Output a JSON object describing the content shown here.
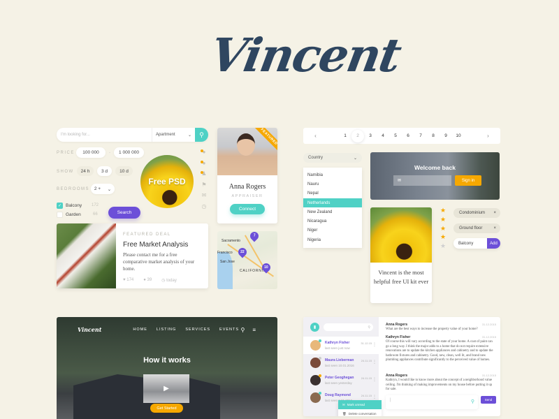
{
  "logo": {
    "text": "Vincent"
  },
  "search": {
    "placeholder": "I'm looking for...",
    "type_value": "Apartment",
    "price_label": "PRICE",
    "price_min": "100 000",
    "price_sep": "-",
    "price_max": "1 000 000",
    "show_label": "SHOW",
    "show_options": [
      "24 h",
      "3 d",
      "10 d"
    ],
    "show_selected": "3 d",
    "bedrooms_label": "BEDROOMS",
    "bedrooms_value": "2 +",
    "filters": [
      {
        "label": "Balcony",
        "count": "172",
        "checked": true
      },
      {
        "label": "Garden",
        "count": "66",
        "checked": false
      }
    ],
    "search_button": "Search"
  },
  "badge": {
    "text": "Free PSD"
  },
  "featured_deal": {
    "kicker": "FEATURED DEAL",
    "title": "Free Market Analysis",
    "body": "Please contact me for a free comparative market analysis of your home.",
    "likes": "174",
    "comments": "39",
    "time": "today"
  },
  "profile": {
    "ribbon": "FEATURED",
    "name": "Anna Rogers",
    "role": "APPRAISER",
    "button": "Connect"
  },
  "map": {
    "cities": [
      "Sacramento",
      "Francisco",
      "San Jose",
      "CALIFORNIA"
    ],
    "pins": [
      "7",
      "22",
      "10"
    ]
  },
  "pagination": {
    "prev": "‹",
    "next": "›",
    "pages": [
      "1",
      "2",
      "3",
      "4",
      "5",
      "6",
      "7",
      "8",
      "9",
      "10"
    ],
    "current": "2"
  },
  "country": {
    "label": "Country",
    "options": [
      "Namibia",
      "Nauru",
      "Nepal",
      "Netherlands",
      "New Zealand",
      "Nicaragua",
      "Niger",
      "Nigeria"
    ],
    "selected": "Netherlands"
  },
  "welcome": {
    "title": "Welcome back",
    "email_icon": "envelope-icon",
    "button": "Sign in"
  },
  "quote": {
    "text": "Vincent is the most helpful free UI kit ever"
  },
  "rating": {
    "value": 4,
    "max": 5
  },
  "tags": {
    "items": [
      "Condominium",
      "Ground floor"
    ],
    "input_value": "Balcony",
    "add_button": "Add"
  },
  "hero": {
    "brand": "Vincent",
    "nav": [
      "HOME",
      "LISTING",
      "SERVICES",
      "EVENTS"
    ],
    "title": "How it works",
    "cta": "Get Started"
  },
  "chat": {
    "contacts": [
      {
        "name": "Kathryn Fisher",
        "last_seen": "last seen just now",
        "date": "31.12.15",
        "status_color": "#4fd1c5"
      },
      {
        "name": "Maura Lieberman",
        "last_seen": "last seen 10.01.2016",
        "date": "24.11.15",
        "status_color": "#cccccc"
      },
      {
        "name": "Peter Geoghegan",
        "last_seen": "last seen yesterday",
        "date": "24.11.15",
        "status_color": "#f6a800"
      },
      {
        "name": "Doug Raymond",
        "last_seen": "last seen 3.01.2016",
        "date": "24.11.15",
        "status_color": "#4fd1c5"
      }
    ],
    "context_menu": [
      "Mark unread",
      "Delete conversation"
    ],
    "messages": [
      {
        "author": "Anna Rogers",
        "date": "31.12.2015",
        "text": "What are the best ways to increase the property value of your home?"
      },
      {
        "author": "Kathryn Fisher",
        "date": "31.12.2015",
        "text": "Of course this will vary according to the state of your home. A coat of paint can go a long way. I think the major adds to a home that do not require extensive renovations are to update the kitchen appliances and cabinetry and to update the bathroom fixtures and cabinetry. Good, new, clean, well lit, and brand new plumbing appliances contribute significantly to the perceived value of homes."
      },
      {
        "author": "Anna Rogers",
        "date": "31.12.2015",
        "text": "Kathryn, I would like to know more about the concept of a neighborhood value ceiling. I'm thinking of making improvements on my house before putting it up for sale."
      }
    ],
    "composer_value": "|",
    "send_button": "Send"
  }
}
